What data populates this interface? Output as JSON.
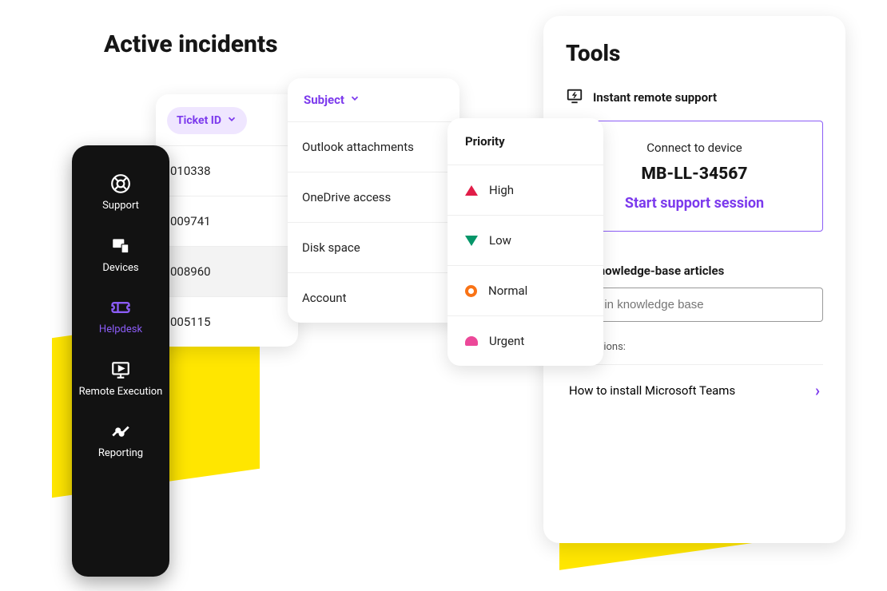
{
  "heading": "Active incidents",
  "sidebar": {
    "items": [
      {
        "label": "Support"
      },
      {
        "label": "Devices"
      },
      {
        "label": "Helpdesk"
      },
      {
        "label": "Remote Execution"
      },
      {
        "label": "Reporting"
      }
    ]
  },
  "tickets": {
    "header": "Ticket ID",
    "rows": [
      "010338",
      "009741",
      "008960",
      "005115"
    ]
  },
  "subjects": {
    "header": "Subject",
    "rows": [
      "Outlook attachments",
      "OneDrive access",
      "Disk space",
      "Account"
    ]
  },
  "priorities": {
    "header": "Priority",
    "rows": [
      {
        "label": "High"
      },
      {
        "label": "Low"
      },
      {
        "label": "Normal"
      },
      {
        "label": "Urgent"
      }
    ]
  },
  "tools": {
    "title": "Tools",
    "remote_label": "Instant remote support",
    "connect_label": "Connect to device",
    "device_id": "MB-LL-34567",
    "start_label": "Start support session",
    "kb_label": "Find knowledge-base articles",
    "kb_placeholder": "Find in knowledge base",
    "suggestions_label": "Suggestions:",
    "suggestion_0": "How to install Microsoft Teams"
  }
}
